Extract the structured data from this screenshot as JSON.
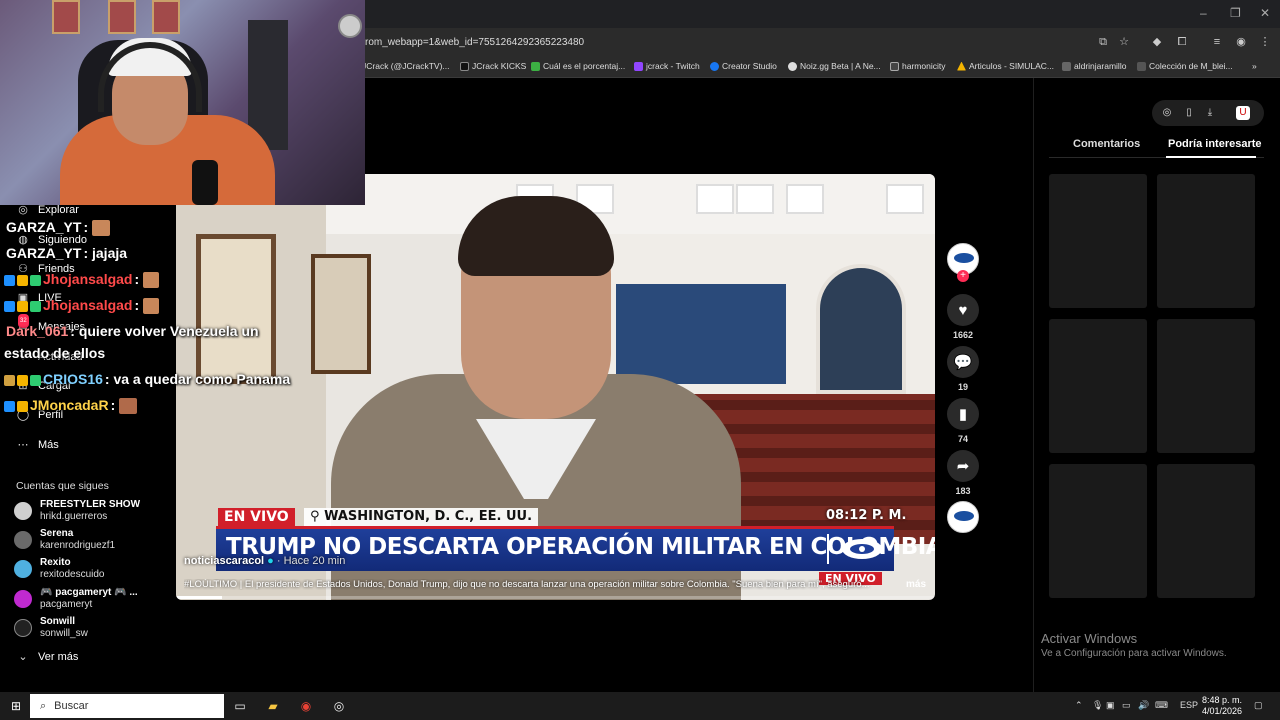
{
  "browser": {
    "url": "rom_webapp=1&web_id=7551264292365223480",
    "bookmarks": [
      "JCrack (@JCrackTV)...",
      "JCrack KICKS",
      "Cuál es el porcentaj...",
      "jcrack - Twitch",
      "Creator Studio",
      "Noiz.gg Beta | A Ne...",
      "harmonicity",
      "Articulos - SIMULAC...",
      "aldrinjaramillo",
      "Colección de M_blei..."
    ],
    "window_controls": [
      "–",
      "❐",
      "✕"
    ]
  },
  "sidebar": {
    "items": [
      {
        "label": "Explorar",
        "icon": "compass-icon"
      },
      {
        "label": "Siguiendo",
        "icon": "following-icon"
      },
      {
        "label": "Friends",
        "icon": "friends-icon"
      },
      {
        "label": "LIVE",
        "icon": "live-icon"
      },
      {
        "label": "Mensajes",
        "icon": "messages-icon",
        "badge": "32"
      },
      {
        "label": "Actividad",
        "icon": "activity-icon"
      },
      {
        "label": "Cargar",
        "icon": "upload-icon"
      },
      {
        "label": "Perfil",
        "icon": "profile-icon"
      }
    ],
    "more_label": "Más",
    "following_title": "Cuentas que sigues",
    "accounts": [
      {
        "name": "FREESTYLER SHOW",
        "handle": "hrikd.guerreros",
        "color": "#cfcfcf"
      },
      {
        "name": "Serena",
        "handle": "karenrodriguezf1",
        "color": "#6a6a6a"
      },
      {
        "name": "Rexito",
        "handle": "rexitodescuido",
        "color": "#4fb0e0"
      },
      {
        "name": "🎮 pacgameryt 🎮 ...",
        "handle": "pacgameryt",
        "color": "#c02ad0"
      },
      {
        "name": "Sonwill",
        "handle": "sonwill_sw",
        "color": "#222222"
      }
    ],
    "see_more": "Ver más"
  },
  "chat": [
    {
      "user": "GARZA_YT",
      "user_color": "#ffffff",
      "text": ":"
    },
    {
      "user": "GARZA_YT",
      "user_color": "#ffffff",
      "text": ": jajaja"
    },
    {
      "user": "Jhojansalgad",
      "user_color": "#ff4a4a",
      "text": ":"
    },
    {
      "user": "Jhojansalgad",
      "user_color": "#ff4a4a",
      "text": ":"
    },
    {
      "user": "Dark_061",
      "user_color": "#ff8a8a",
      "text": ": quiere volver Venezuela un"
    },
    {
      "user": "",
      "user_color": "#ffffff",
      "text": "estado de ellos"
    },
    {
      "user": "CRIOS16",
      "user_color": "#7fd0ff",
      "text": ": va a quedar como Panama"
    },
    {
      "user": "JMoncadaR",
      "user_color": "#ffd34a",
      "text": ":"
    }
  ],
  "video": {
    "live_tag": "EN VIVO",
    "location": "WASHINGTON, D. C., EE. UU.",
    "broadcast_time": "08:12 P. M.",
    "headline": "TRUMP NO DESCARTA OPERACIÓN MILITAR EN COLOMBIA",
    "live_tag_small": "EN VIVO",
    "author": "noticiascaracol",
    "posted": "· Hace 20 min",
    "caption": "#LOÚLTIMO | El presidente de Estados Unidos, Donald Trump, dijo que no descarta lanzar una operación militar sobre Colombia. \"Suena bien para mí\", aseguró...",
    "more_label": "más",
    "progress": 0.06
  },
  "actions": {
    "likes": "1662",
    "comments": "19",
    "saves": "74",
    "shares": "183"
  },
  "right_panel": {
    "tab_comments": "Comentarios",
    "tab_suggested": "Podría interesarte",
    "activate_title": "Activar Windows",
    "activate_sub": "Ve a Configuración para activar Windows."
  },
  "taskbar": {
    "search_placeholder": "Buscar",
    "lang": "ESP",
    "time": "8:48 p. m.",
    "date": "4/01/2026"
  }
}
